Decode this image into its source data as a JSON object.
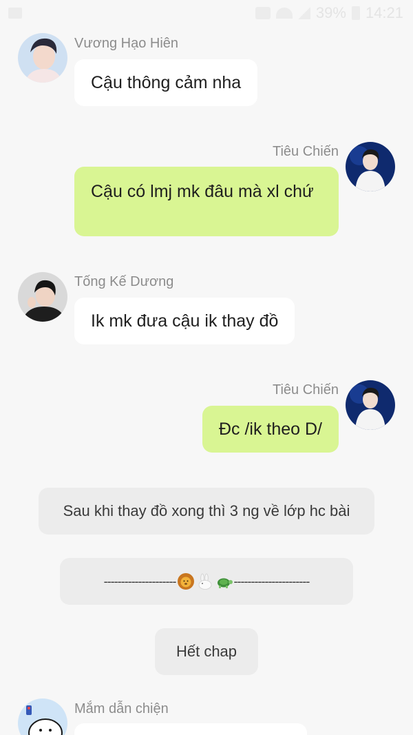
{
  "status_bar": {
    "battery": "39%",
    "time": "14:21"
  },
  "messages": [
    {
      "sender": "Vương Hạo Hiên",
      "text": "Cậu thông cảm nha",
      "side": "left",
      "avatar": "boy-avatar-icon"
    },
    {
      "sender": "Tiêu Chiến",
      "text": "Cậu có lmj mk đâu mà xl chứ",
      "side": "right",
      "avatar": "boy-avatar-icon"
    },
    {
      "sender": "Tống Kế Dương",
      "text": "Ik mk đưa cậu ik thay đồ",
      "side": "left",
      "avatar": "boy-avatar-icon"
    },
    {
      "sender": "Tiêu Chiến",
      "text": "Đc /ik theo D/",
      "side": "right",
      "avatar": "boy-avatar-icon"
    }
  ],
  "narration_1": "Sau khi thay đồ xong thì 3 ng về lớp hc bài",
  "separator": {
    "left_dashes": "---------------------",
    "right_dashes": "----------------------",
    "icons": [
      "lion-icon",
      "rabbit-icon",
      "turtle-icon"
    ]
  },
  "end_label": "Hết chap",
  "last_sender": "Mắm dẫn chiện",
  "colors": {
    "background": "#f7f7f7",
    "left_bubble": "#ffffff",
    "right_bubble": "#d9f593",
    "narration": "#ececec",
    "sender_text": "#8c8c8c"
  }
}
